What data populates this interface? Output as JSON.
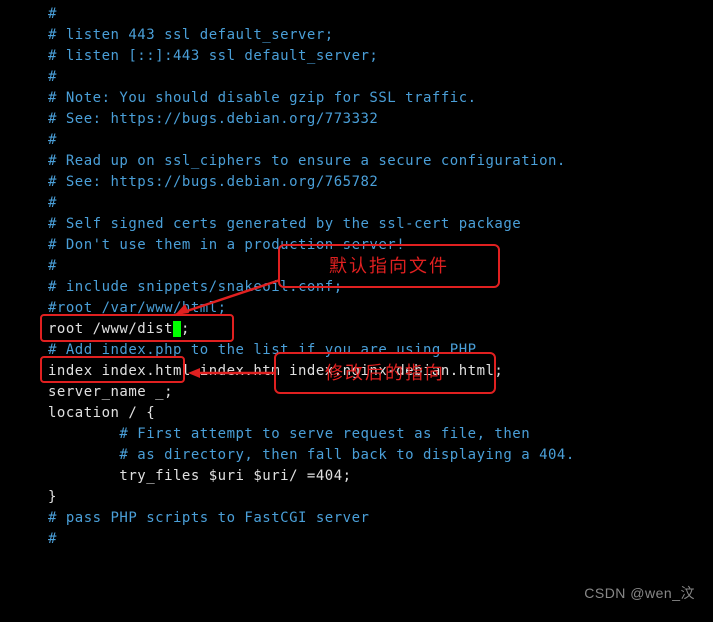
{
  "lines": {
    "l0": "#",
    "l1": "# listen 443 ssl default_server;",
    "l2": "# listen [::]:443 ssl default_server;",
    "l3": "#",
    "l4": "# Note: You should disable gzip for SSL traffic.",
    "l5": "# See: https://bugs.debian.org/773332",
    "l6": "#",
    "l7": "# Read up on ssl_ciphers to ensure a secure configuration.",
    "l8": "# See: https://bugs.debian.org/765782",
    "l9": "#",
    "l10": "# Self signed certs generated by the ssl-cert package",
    "l11": "# Don't use them in a production server!",
    "l12": "#",
    "l13": "# include snippets/snakeoil.conf;",
    "l14_empty": "",
    "l15": "#root /var/www/html;",
    "l16_empty": "",
    "l17a": "root /www/dist",
    "l17b": ";",
    "l18": "# Add index.php to the list if you are using PHP",
    "l19": "index index.html index.htm index.nginx-debian.html;",
    "l20_empty": "",
    "l21": "server_name _;",
    "l22_empty": "",
    "l23": "location / {",
    "l24": "        # First attempt to serve request as file, then",
    "l25": "        # as directory, then fall back to displaying a 404.",
    "l26": "        try_files $uri $uri/ =404;",
    "l27": "}",
    "l28_empty": "",
    "l29": "# pass PHP scripts to FastCGI server",
    "l30": "#"
  },
  "annotations": {
    "box1_label": "默认指向文件",
    "box2_label": "修改后的指向"
  },
  "watermark": "CSDN @wen_汶"
}
